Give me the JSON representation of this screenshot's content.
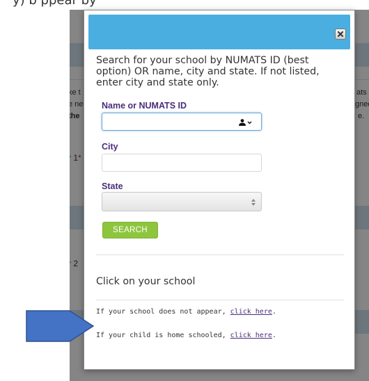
{
  "caption": {
    "partial_text": "y) b                                                                      ppear by"
  },
  "background": {
    "fragments": [
      {
        "id": "left-1",
        "text": "ke t"
      },
      {
        "id": "left-2",
        "text": "e ne"
      },
      {
        "id": "left-3",
        "text": "the"
      },
      {
        "id": "left-4",
        "text": "r 1"
      },
      {
        "id": "left-5",
        "text": "r 2"
      },
      {
        "id": "right-1",
        "text": "ats"
      },
      {
        "id": "right-2",
        "text": "gned"
      },
      {
        "id": "right-3",
        "text": "e."
      }
    ],
    "required_mark": "*"
  },
  "modal": {
    "instructions": "Search for your school by NUMATS ID (best option) OR name, city and state. If not listed, enter city and state only.",
    "fields": {
      "name_label": "Name or NUMATS ID",
      "name_value": "",
      "city_label": "City",
      "city_value": "",
      "state_label": "State",
      "state_value": ""
    },
    "search_button": "SEARCH",
    "results_heading": "Click on your school",
    "footnotes": {
      "not_appear_text": "If your school does not appear, ",
      "not_appear_link": "click here",
      "home_schooled_text": "If your child is home schooled, ",
      "home_schooled_link": "click here",
      "period": "."
    },
    "icons": {
      "close": "close-icon",
      "contact": "person-icon",
      "select": "select-arrows-icon"
    }
  },
  "colors": {
    "header": "#4aaee0",
    "search_button": "#8ec53f",
    "label": "#4a2d7a",
    "arrow": "#4472c4"
  }
}
